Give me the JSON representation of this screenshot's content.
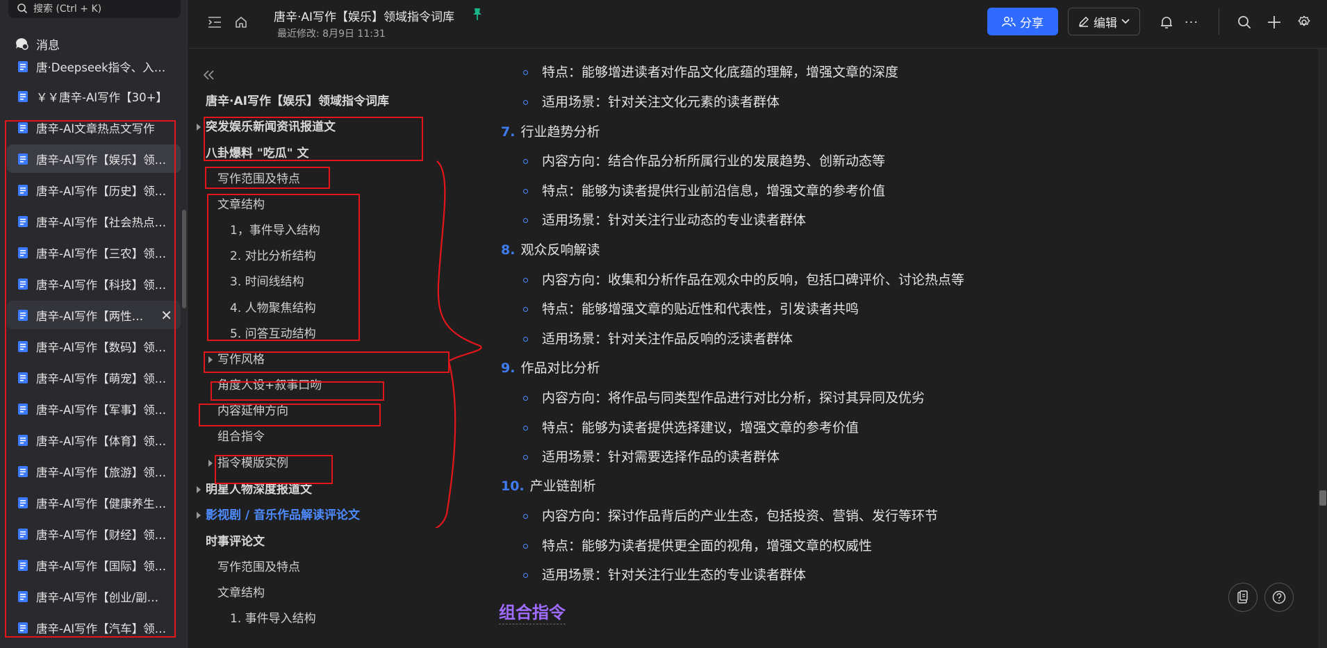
{
  "colors": {
    "accent": "#2f6bff",
    "link": "#4d8bff",
    "annotation_red": "#e3161b",
    "heading_purple": "#a06bff"
  },
  "sidebar": {
    "search_placeholder": "搜索 (Ctrl + K)",
    "messages_label": "消息",
    "items": [
      {
        "label": "唐·Deepseek指令、入门到精通",
        "icon": "doc-icon"
      },
      {
        "label": "￥￥唐辛-AI写作【30+】",
        "icon": "doc-icon"
      },
      {
        "label": "唐辛-AI文章热点文写作",
        "icon": "doc-icon"
      },
      {
        "label": "唐辛-AI写作【娱乐】领域指令词库",
        "icon": "doc-icon",
        "selected": true
      },
      {
        "label": "唐辛-AI写作【历史】领域指令词库",
        "icon": "doc-icon"
      },
      {
        "label": "唐辛-AI写作【社会热点】领域指令词库",
        "icon": "doc-icon"
      },
      {
        "label": "唐辛-AI写作【三农】领域指令词库",
        "icon": "doc-icon"
      },
      {
        "label": "唐辛-AI写作【科技】领域指令词库",
        "icon": "doc-icon"
      },
      {
        "label": "唐辛-AI写作【两性情感】领域指令词库",
        "icon": "doc-icon",
        "hovered": true
      },
      {
        "label": "唐辛-AI写作【数码】领域指令词库",
        "icon": "doc-icon"
      },
      {
        "label": "唐辛-AI写作【萌宠】领域指令词库",
        "icon": "doc-icon"
      },
      {
        "label": "唐辛-AI写作【军事】领域指令词库",
        "icon": "doc-icon"
      },
      {
        "label": "唐辛-AI写作【体育】领域指令词库",
        "icon": "doc-icon"
      },
      {
        "label": "唐辛-AI写作【旅游】领域指令词库",
        "icon": "doc-icon"
      },
      {
        "label": "唐辛-AI写作【健康养生】领域指令词库",
        "icon": "doc-icon"
      },
      {
        "label": "唐辛-AI写作【财经】领域指令词库",
        "icon": "doc-icon"
      },
      {
        "label": "唐辛-AI写作【国际】领域指令词库",
        "icon": "doc-icon"
      },
      {
        "label": "唐辛-AI写作【创业/副业】领域指令词库",
        "icon": "doc-icon"
      },
      {
        "label": "唐辛-AI写作【汽车】领域指令词库",
        "icon": "doc-icon"
      }
    ],
    "close_glyph": "✕"
  },
  "header": {
    "title": "唐辛·AI写作【娱乐】领域指令词库",
    "last_modified": "最近修改: 8月9日 11:31",
    "share_label": "分享",
    "edit_label": "编辑",
    "more_glyph": "···"
  },
  "outline": {
    "collapse_glyph": "«",
    "items": [
      {
        "label": "唐辛·AI写作【娱乐】领域指令词库",
        "level": 1
      },
      {
        "label": "突发娱乐新闻资讯报道文",
        "level": 1,
        "collapsed": true
      },
      {
        "label": "八卦爆料 \"吃瓜\" 文",
        "level": 1
      },
      {
        "label": "写作范围及特点",
        "level": 2
      },
      {
        "label": "文章结构",
        "level": 2
      },
      {
        "label": "1，事件导入结构",
        "level": 3
      },
      {
        "label": "2. 对比分析结构",
        "level": 3
      },
      {
        "label": "3. 时间线结构",
        "level": 3
      },
      {
        "label": "4. 人物聚焦结构",
        "level": 3
      },
      {
        "label": "5. 问答互动结构",
        "level": 3
      },
      {
        "label": "写作风格",
        "level": 2,
        "collapsed": true
      },
      {
        "label": "角度人设+叙事口吻",
        "level": 2
      },
      {
        "label": "内容延伸方向",
        "level": 2
      },
      {
        "label": "组合指令",
        "level": 2
      },
      {
        "label": "指令模版实例",
        "level": 2,
        "collapsed": true
      },
      {
        "label": "明星人物深度报道文",
        "level": 1,
        "collapsed": true
      },
      {
        "label": "影视剧 / 音乐作品解读评论文",
        "level": 1,
        "collapsed": true,
        "active": true
      },
      {
        "label": "时事评论文",
        "level": 1
      },
      {
        "label": "写作范围及特点",
        "level": 2
      },
      {
        "label": "文章结构",
        "level": 2
      },
      {
        "label": "1. 事件导入结构",
        "level": 3
      }
    ]
  },
  "content": {
    "lines": [
      {
        "type": "bullet",
        "text": "特点：能够增进读者对作品文化底蕴的理解，增强文章的深度"
      },
      {
        "type": "bullet",
        "text": "适用场景：针对关注文化元素的读者群体"
      },
      {
        "type": "numbered",
        "num": "7.",
        "text": "行业趋势分析"
      },
      {
        "type": "bullet",
        "text": "内容方向：结合作品分析所属行业的发展趋势、创新动态等"
      },
      {
        "type": "bullet",
        "text": "特点：能够为读者提供行业前沿信息，增强文章的参考价值"
      },
      {
        "type": "bullet",
        "text": "适用场景：针对关注行业动态的专业读者群体"
      },
      {
        "type": "numbered",
        "num": "8.",
        "text": "观众反响解读"
      },
      {
        "type": "bullet",
        "text": "内容方向：收集和分析作品在观众中的反响，包括口碑评价、讨论热点等"
      },
      {
        "type": "bullet",
        "text": "特点：能够增强文章的贴近性和代表性，引发读者共鸣"
      },
      {
        "type": "bullet",
        "text": "适用场景：针对关注作品反响的泛读者群体"
      },
      {
        "type": "numbered",
        "num": "9.",
        "text": "作品对比分析"
      },
      {
        "type": "bullet",
        "text": "内容方向：将作品与同类型作品进行对比分析，探讨其异同及优劣"
      },
      {
        "type": "bullet",
        "text": "特点：能够为读者提供选择建议，增强文章的参考价值"
      },
      {
        "type": "bullet",
        "text": "适用场景：针对需要选择作品的读者群体"
      },
      {
        "type": "numbered",
        "num": "10.",
        "text": "产业链剖析"
      },
      {
        "type": "bullet",
        "text": "内容方向：探讨作品背后的产业生态，包括投资、营销、发行等环节"
      },
      {
        "type": "bullet",
        "text": "特点：能够为读者提供更全面的视角，增强文章的权威性"
      },
      {
        "type": "bullet",
        "text": "适用场景：针对关注行业生态的专业读者群体"
      }
    ],
    "section_heading": "组合指令"
  }
}
